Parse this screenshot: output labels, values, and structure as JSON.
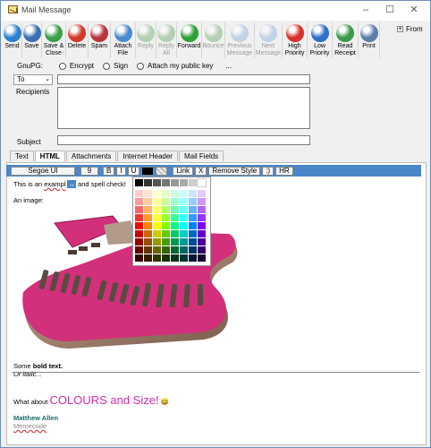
{
  "window": {
    "title": "Mail Message",
    "minimize": "–",
    "maximize": "☐",
    "close": "✕"
  },
  "toolbar": [
    {
      "id": "send",
      "label": "Send",
      "color": "#2e7fd1",
      "disabled": false
    },
    {
      "id": "save",
      "label": "Save",
      "color": "#3a6fb0",
      "disabled": false
    },
    {
      "id": "save-close",
      "label": "Save &\nClose",
      "color": "#3aa04a",
      "disabled": false
    },
    {
      "id": "delete",
      "label": "Delete",
      "color": "#d23a2a",
      "disabled": false
    },
    {
      "id": "spam",
      "label": "Spam",
      "color": "#b8343e",
      "disabled": false
    },
    {
      "id": "attach",
      "label": "Attach\nFile",
      "color": "#4a8ad0",
      "disabled": false
    },
    {
      "id": "reply",
      "label": "Reply",
      "color": "#6aa86a",
      "disabled": true
    },
    {
      "id": "reply-all",
      "label": "Reply\nAll",
      "color": "#6aa86a",
      "disabled": true
    },
    {
      "id": "forward",
      "label": "Forward",
      "color": "#2f9f3a",
      "disabled": false
    },
    {
      "id": "bounce",
      "label": "Bounce",
      "color": "#6aa86a",
      "disabled": true
    },
    {
      "id": "prev",
      "label": "Previous\nMessage",
      "color": "#8ab0d8",
      "disabled": true
    },
    {
      "id": "next",
      "label": "Next\nMessage",
      "color": "#8ab0d8",
      "disabled": true
    },
    {
      "id": "high",
      "label": "High\nPriority",
      "color": "#d8302a",
      "disabled": false
    },
    {
      "id": "low",
      "label": "Low\nPriority",
      "color": "#2e6fc8",
      "disabled": false
    },
    {
      "id": "receipt",
      "label": "Read\nReceipt",
      "color": "#3a9a4a",
      "disabled": false
    },
    {
      "id": "print",
      "label": "Print",
      "color": "#5a7ea8",
      "disabled": false
    }
  ],
  "from": {
    "label": "From",
    "toggle": "+"
  },
  "gpg": {
    "label": "GnuPG:",
    "encrypt": "Encrypt",
    "sign": "Sign",
    "attach_key": "Attach my public key",
    "more": "..."
  },
  "to_select": {
    "value": "To",
    "chevron": "⌄"
  },
  "recipients_label": "Recipients",
  "subject_label": "Subject",
  "tabs": [
    "Text",
    "HTML",
    "Attachments",
    "Internet Header",
    "Mail Fields"
  ],
  "active_tab": "HTML",
  "format": {
    "font": "Segoe UI",
    "size": "9",
    "bold": "B",
    "italic": "I",
    "underline": "U",
    "link": "Link",
    "x": "X",
    "remove_style": "Remove Style",
    "smiley": ":)",
    "hr": "HR"
  },
  "body": {
    "line1_prefix": "This is an ",
    "line1_misspelled": "exampl",
    "line1_emoji": "↔",
    "line1_suffix": " and spell check!",
    "image_label": "An image:",
    "some": "Some ",
    "bold_text": "bold text.",
    "italic_text": "Or italic...",
    "colours_prefix": "What about ",
    "colours_big": "COLOURS and Size!",
    "colours_emoji": "😂",
    "sig_name": "Matthew Allen",
    "sig_company": "Memecode"
  },
  "palette_colors": {
    "gray_row": [
      "#000000",
      "#333333",
      "#555555",
      "#777777",
      "#999999",
      "#aaaaaa",
      "#cccccc",
      "#ffffff"
    ],
    "rows": [
      [
        "#ffcccc",
        "#ffe5cc",
        "#ffffcc",
        "#e5ffcc",
        "#ccffe5",
        "#ccffff",
        "#cce5ff",
        "#e5ccff"
      ],
      [
        "#ff9999",
        "#ffcc99",
        "#ffff99",
        "#ccff99",
        "#99ffcc",
        "#99ffff",
        "#99ccff",
        "#cc99ff"
      ],
      [
        "#ff6666",
        "#ffb266",
        "#ffff66",
        "#b2ff66",
        "#66ffb2",
        "#66ffff",
        "#66b2ff",
        "#b266ff"
      ],
      [
        "#ff3333",
        "#ff9933",
        "#ffff33",
        "#99ff33",
        "#33ff99",
        "#33ffff",
        "#3399ff",
        "#9933ff"
      ],
      [
        "#ff0000",
        "#ff8000",
        "#ffff00",
        "#80ff00",
        "#00ff80",
        "#00ffff",
        "#0080ff",
        "#8000ff"
      ],
      [
        "#cc0000",
        "#cc6600",
        "#cccc00",
        "#66cc00",
        "#00cc66",
        "#00cccc",
        "#0066cc",
        "#6600cc"
      ],
      [
        "#990000",
        "#994c00",
        "#999900",
        "#4c9900",
        "#00994c",
        "#009999",
        "#004c99",
        "#4c0099"
      ],
      [
        "#660000",
        "#663300",
        "#666600",
        "#336600",
        "#006633",
        "#006666",
        "#003366",
        "#330066"
      ],
      [
        "#330000",
        "#331900",
        "#333300",
        "#193300",
        "#003319",
        "#003333",
        "#001933",
        "#190033"
      ]
    ]
  },
  "colors": {
    "accent_bar": "#4a86c8",
    "guitar": "#d2307a",
    "sig_name": "#1a6a6a",
    "colours": "#d22bb0"
  }
}
